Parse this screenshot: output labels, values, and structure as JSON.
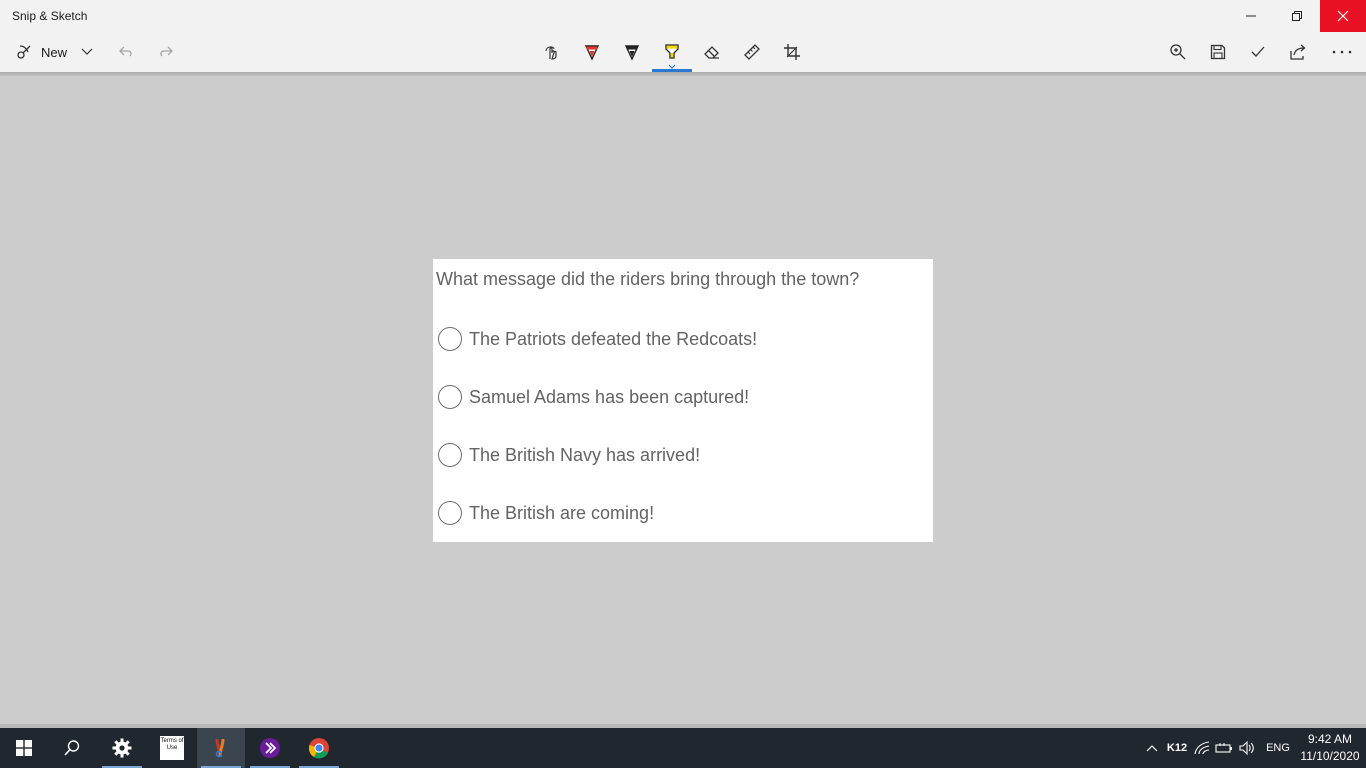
{
  "window": {
    "title": "Snip & Sketch",
    "controls": {
      "minimize_icon": "minimize-icon",
      "restore_icon": "restore-icon",
      "close_icon": "close-icon",
      "close_color": "#e81123"
    }
  },
  "toolbar": {
    "new_label": "New",
    "left_icons": [
      "new-snip-icon",
      "chevron-down-icon",
      "undo-icon",
      "redo-icon"
    ],
    "tools": [
      "touch-writing-icon",
      "ballpoint-pen-icon",
      "pencil-icon",
      "highlighter-icon",
      "eraser-icon",
      "ruler-icon",
      "crop-icon"
    ],
    "active_tool": "highlighter-icon",
    "right_icons": [
      "zoom-icon",
      "save-icon",
      "copy-checkmark-icon",
      "share-icon",
      "more-icon"
    ],
    "accent_color": "#2a7ad5"
  },
  "canvas": {
    "question": "What message did the riders bring through the town?",
    "options": [
      {
        "label": "The Patriots defeated the Redcoats!"
      },
      {
        "label": "Samuel Adams has been captured!"
      },
      {
        "label": "The British Navy has arrived!"
      },
      {
        "label": "The British are coming!"
      }
    ]
  },
  "taskbar": {
    "pinned": [
      "windows-start-icon",
      "search-icon",
      "settings-icon",
      "terms-of-use-icon",
      "snip-sketch-icon",
      "power-automate-icon",
      "chrome-icon"
    ],
    "terms_text": "Terms of Use",
    "tray": {
      "chevron_icon": "tray-chevron-up-icon",
      "k12_label": "K12",
      "icons": [
        "wifi-icon",
        "battery-icon",
        "volume-icon"
      ],
      "language": "ENG",
      "time": "9:42 AM",
      "date": "11/10/2020"
    },
    "background_color": "#20272e"
  }
}
